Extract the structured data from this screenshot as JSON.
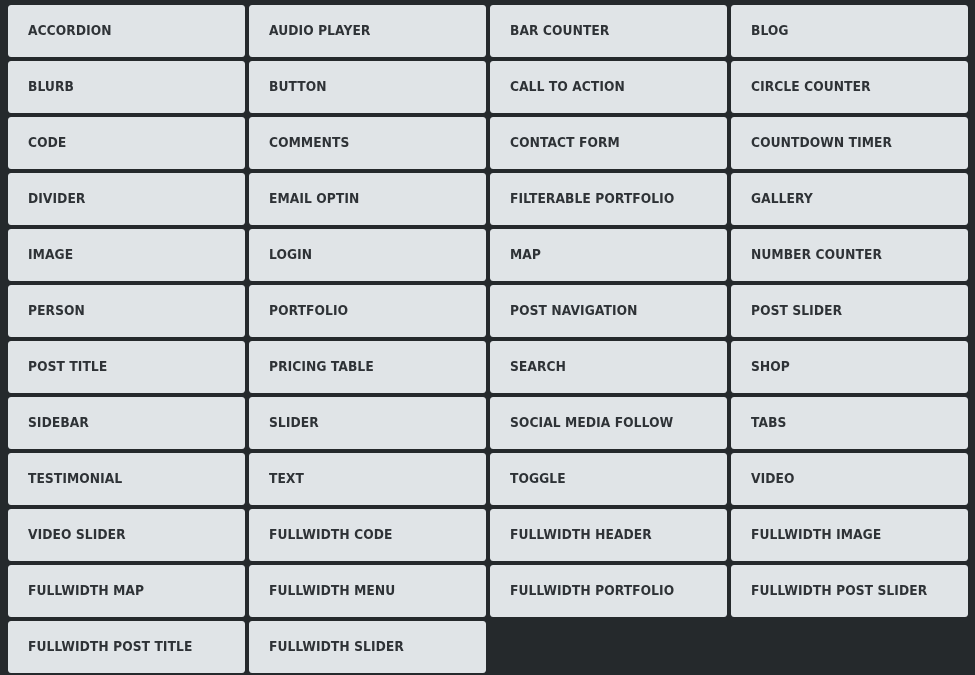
{
  "modules": [
    {
      "label": "ACCORDION"
    },
    {
      "label": "AUDIO PLAYER"
    },
    {
      "label": "BAR COUNTER"
    },
    {
      "label": "BLOG"
    },
    {
      "label": "BLURB"
    },
    {
      "label": "BUTTON"
    },
    {
      "label": "CALL TO ACTION"
    },
    {
      "label": "CIRCLE COUNTER"
    },
    {
      "label": "CODE"
    },
    {
      "label": "COMMENTS"
    },
    {
      "label": "CONTACT FORM"
    },
    {
      "label": "COUNTDOWN TIMER"
    },
    {
      "label": "DIVIDER"
    },
    {
      "label": "EMAIL OPTIN"
    },
    {
      "label": "FILTERABLE PORTFOLIO"
    },
    {
      "label": "GALLERY"
    },
    {
      "label": "IMAGE"
    },
    {
      "label": "LOGIN"
    },
    {
      "label": "MAP"
    },
    {
      "label": "NUMBER COUNTER"
    },
    {
      "label": "PERSON"
    },
    {
      "label": "PORTFOLIO"
    },
    {
      "label": "POST NAVIGATION"
    },
    {
      "label": "POST SLIDER"
    },
    {
      "label": "POST TITLE"
    },
    {
      "label": "PRICING TABLE"
    },
    {
      "label": "SEARCH"
    },
    {
      "label": "SHOP"
    },
    {
      "label": "SIDEBAR"
    },
    {
      "label": "SLIDER"
    },
    {
      "label": "SOCIAL MEDIA FOLLOW"
    },
    {
      "label": "TABS"
    },
    {
      "label": "TESTIMONIAL"
    },
    {
      "label": "TEXT"
    },
    {
      "label": "TOGGLE"
    },
    {
      "label": "VIDEO"
    },
    {
      "label": "VIDEO SLIDER"
    },
    {
      "label": "FULLWIDTH CODE"
    },
    {
      "label": "FULLWIDTH HEADER"
    },
    {
      "label": "FULLWIDTH IMAGE"
    },
    {
      "label": "FULLWIDTH MAP"
    },
    {
      "label": "FULLWIDTH MENU"
    },
    {
      "label": "FULLWIDTH PORTFOLIO"
    },
    {
      "label": "FULLWIDTH POST SLIDER"
    },
    {
      "label": "FULLWIDTH POST TITLE"
    },
    {
      "label": "FULLWIDTH SLIDER"
    }
  ],
  "colors": {
    "background": "#25292c",
    "tile": "#e0e4e7",
    "text": "#2e3236"
  }
}
